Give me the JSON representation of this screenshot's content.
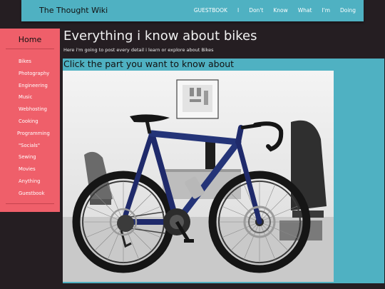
{
  "header": {
    "site_title": "The Thought Wiki",
    "nav": [
      "GUESTBOOK",
      "I",
      "Don't",
      "Know",
      "What",
      "I'm",
      "Doing"
    ]
  },
  "sidebar": {
    "home": "Home",
    "items": [
      "Bikes",
      "Photography",
      "Engineering",
      "Music",
      "Webhosting",
      "Cooking",
      "Programming",
      "\"Socials\"",
      "Sewing",
      "Movies",
      "Anything",
      "Guestbook"
    ]
  },
  "main": {
    "title": "Everything i know about bikes",
    "subtitle": "Here i'm going to post every detail i learn or explore about Bikes",
    "prompt": "Click the part you want to know about"
  },
  "colors": {
    "accent_teal": "#4fb1c2",
    "sidebar_red": "#ef5f6a",
    "background": "#251e22",
    "bike_blue": "#1f2a6b"
  }
}
